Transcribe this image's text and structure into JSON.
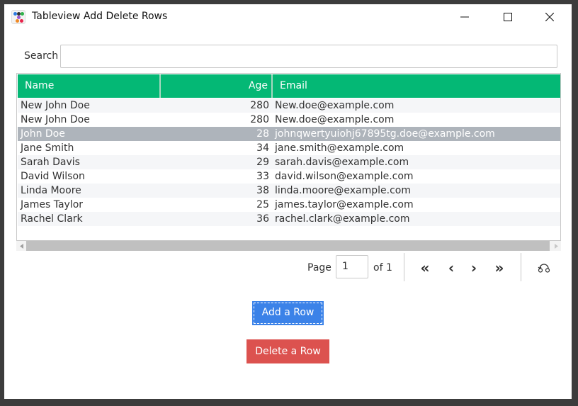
{
  "window": {
    "title": "Tableview Add Delete Rows",
    "controls": {
      "minimize": "minimize-icon",
      "maximize": "maximize-icon",
      "close": "close-icon"
    }
  },
  "search": {
    "label": "Search",
    "value": "",
    "placeholder": ""
  },
  "table": {
    "header_color": "#04b875",
    "selected_color": "#aeb4bb",
    "columns": [
      {
        "key": "name",
        "label": "Name"
      },
      {
        "key": "age",
        "label": "Age"
      },
      {
        "key": "email",
        "label": "Email"
      }
    ],
    "rows": [
      {
        "name": "New John Doe",
        "age": "280",
        "email": "New.doe@example.com"
      },
      {
        "name": "New John Doe",
        "age": "280",
        "email": "New.doe@example.com"
      },
      {
        "name": "John Doe",
        "age": "28",
        "email": "johnqwertyuiohj67895tg.doe@example.com",
        "selected": true
      },
      {
        "name": "Jane Smith",
        "age": "34",
        "email": "jane.smith@example.com"
      },
      {
        "name": "Sarah Davis",
        "age": "29",
        "email": "sarah.davis@example.com"
      },
      {
        "name": "David Wilson",
        "age": "33",
        "email": "david.wilson@example.com"
      },
      {
        "name": "Linda Moore",
        "age": "38",
        "email": "linda.moore@example.com"
      },
      {
        "name": "James Taylor",
        "age": "25",
        "email": "james.taylor@example.com"
      },
      {
        "name": "Rachel Clark",
        "age": "36",
        "email": "rachel.clark@example.com"
      }
    ]
  },
  "pagination": {
    "page_label": "Page",
    "current_page": "1",
    "of_label": "of 1",
    "first_glyph": "«",
    "prev_glyph": "‹",
    "next_glyph": "›",
    "last_glyph": "»",
    "reset_icon": "reset-icon"
  },
  "buttons": {
    "add": {
      "label": "Add a Row",
      "color": "#3b82e8"
    },
    "delete": {
      "label": "Delete a Row",
      "color": "#dc524f"
    }
  }
}
